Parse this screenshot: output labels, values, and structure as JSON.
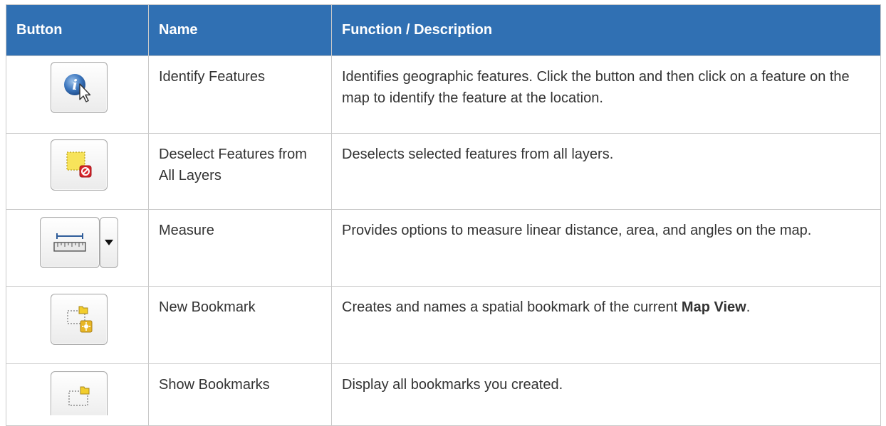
{
  "table": {
    "headers": {
      "button": "Button",
      "name": "Name",
      "function": "Function / Description"
    },
    "rows": [
      {
        "icon": "identify-features-icon",
        "name": "Identify Features",
        "description": "Identifies geographic features. Click the button and then click on a feature on the map to identify the feature at the location."
      },
      {
        "icon": "deselect-features-icon",
        "name": "Deselect Features from All Layers",
        "description": "Deselects selected features from all layers."
      },
      {
        "icon": "measure-ruler-icon",
        "name": "Measure",
        "description": "Provides options to measure linear distance, area, and angles on the map."
      },
      {
        "icon": "new-bookmark-icon",
        "name": "New Bookmark",
        "description_pre": "Creates and names a spatial bookmark of the current ",
        "description_bold": "Map View",
        "description_post": "."
      },
      {
        "icon": "show-bookmarks-icon",
        "name": "Show Bookmarks",
        "description": "Display all bookmarks you created."
      }
    ]
  },
  "colors": {
    "header_background": "#3070b3",
    "header_text": "#ffffff",
    "body_text": "#333333",
    "grid_line": "#c9c9c9"
  }
}
